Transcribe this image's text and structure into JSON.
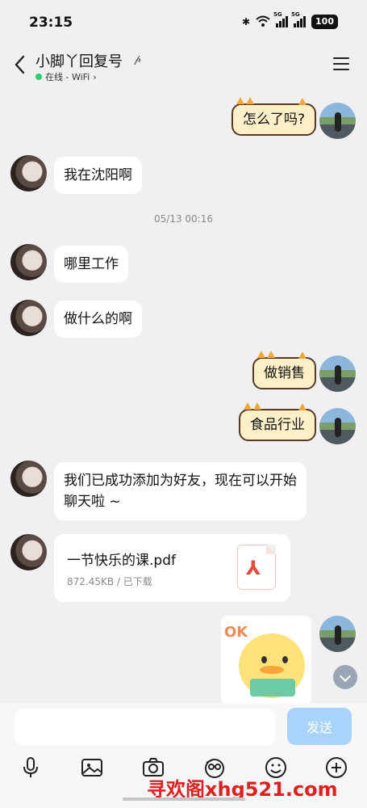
{
  "status_bar": {
    "time": "23:15",
    "network1": "5G",
    "network2": "5G",
    "battery": "100"
  },
  "header": {
    "contact_name": "小脚丫回复号",
    "status_text": "在线 - WiFi"
  },
  "messages": {
    "m1": "怎么了吗?",
    "m2": "我在沈阳啊",
    "timestamp": "05/13 00:16",
    "m3": "哪里工作",
    "m4": "做什么的啊",
    "m5": "做销售",
    "m6": "食品行业",
    "m7": "我们已成功添加为好友，现在可以开始聊天啦 ~",
    "file": {
      "name": "一节快乐的课.pdf",
      "meta": "872.45KB / 已下载",
      "icon": "pdf-icon"
    },
    "sticker_text": "OK"
  },
  "input_bar": {
    "placeholder": "",
    "send_label": "发送"
  },
  "toolbar": [
    "microphone-icon",
    "image-icon",
    "camera-icon",
    "sticker-icon",
    "emoji-icon",
    "plus-icon"
  ],
  "watermark": "寻欢阁xhg521.com",
  "colors": {
    "accent": "#a8d3fa",
    "cat_bubble": "#fdf0c8",
    "online": "#2dcc70",
    "pdf": "#e8483a"
  }
}
